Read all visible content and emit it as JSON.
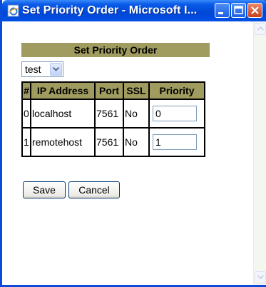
{
  "window": {
    "title": "Set Priority Order - Microsoft I..."
  },
  "page": {
    "heading": "Set Priority Order",
    "selector": {
      "selected": "test"
    },
    "table": {
      "headers": [
        "#",
        "IP Address",
        "Port",
        "SSL",
        "Priority"
      ],
      "rows": [
        {
          "index": "0",
          "ip": "localhost",
          "port": "7561",
          "ssl": "No",
          "priority": "0"
        },
        {
          "index": "1",
          "ip": "remotehost",
          "port": "7561",
          "ssl": "No",
          "priority": "1"
        }
      ]
    },
    "buttons": {
      "save": "Save",
      "cancel": "Cancel"
    }
  },
  "colors": {
    "header_bg": "#a09b5e",
    "titlebar": "#0a5be8"
  },
  "icons": [
    "ie-page-icon",
    "minimize-icon",
    "maximize-icon",
    "close-icon",
    "scroll-up-icon",
    "scroll-down-icon",
    "dropdown-arrow-icon"
  ]
}
